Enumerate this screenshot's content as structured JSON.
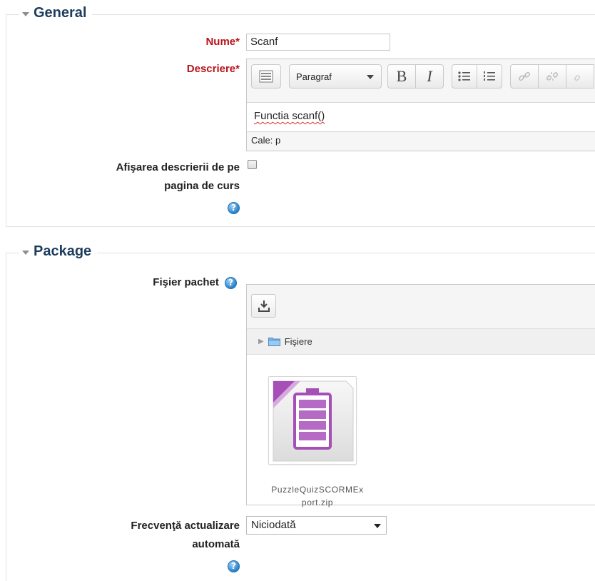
{
  "general": {
    "legend": "General",
    "name_label": "Nume",
    "name_value": "Scanf",
    "required_mark": "*",
    "description_label": "Descriere",
    "editor": {
      "paragraph_label": "Paragraf",
      "bold_label": "B",
      "italic_label": "I",
      "content": "Functia scanf()",
      "path": "Cale: p"
    },
    "show_description_label_line1": "Afişarea descrierii de pe",
    "show_description_label_line2": "pagina de curs",
    "show_description_checked": false
  },
  "package": {
    "legend": "Package",
    "file_label": "Fişier pachet",
    "filepicker": {
      "path_label": "Fişiere",
      "file_name_line1": "PuzzleQuizSCORMEx",
      "file_name_line2": "port.zip"
    },
    "update_freq_label_line1": "Frecvenţă actualizare",
    "update_freq_label_line2": "automată",
    "update_freq_value": "Niciodată"
  },
  "colors": {
    "required": "#b8141b",
    "legend": "#1d3d5c",
    "help": "#2b83cc",
    "zip_icon": "#a54fb7"
  },
  "icons": [
    "chevron-down-icon",
    "help-icon",
    "toolbar-toggle-icon",
    "bullet-list-icon",
    "numbered-list-icon",
    "link-icon",
    "unlink-icon",
    "upload-icon",
    "folder-icon",
    "zip-file-icon"
  ]
}
